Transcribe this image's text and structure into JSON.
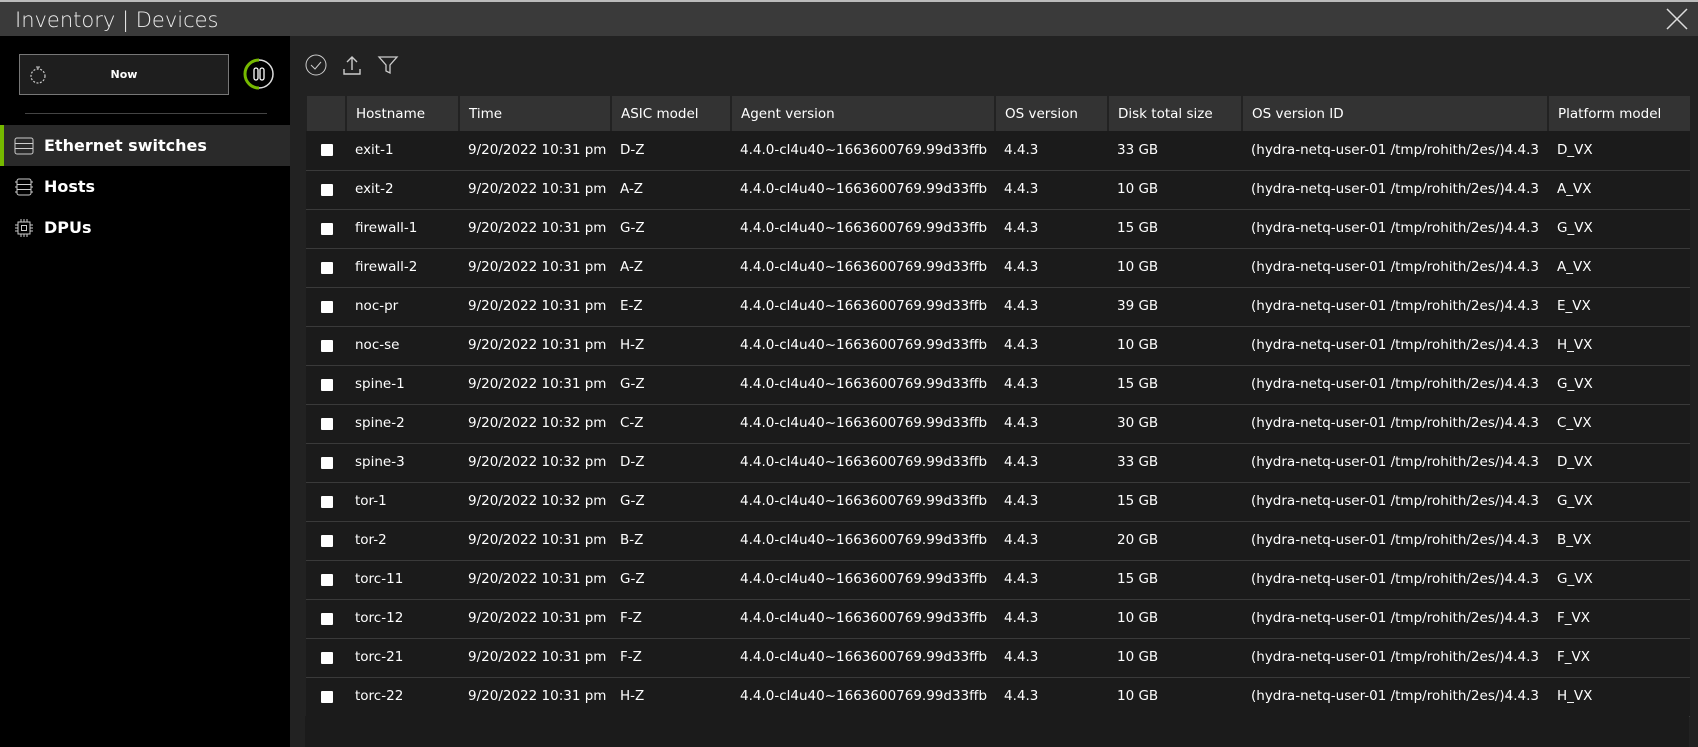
{
  "window": {
    "title": "Inventory | Devices"
  },
  "time_control": {
    "label": "Now"
  },
  "sidebar": {
    "items": [
      {
        "label": "Ethernet switches",
        "icon": "switch-icon"
      },
      {
        "label": "Hosts",
        "icon": "server-icon"
      },
      {
        "label": "DPUs",
        "icon": "chip-icon"
      }
    ]
  },
  "table": {
    "columns": [
      "Hostname",
      "Time",
      "ASIC model",
      "Agent version",
      "OS version",
      "Disk total size",
      "OS version ID",
      "Platform model"
    ],
    "rows": [
      [
        "exit-1",
        "9/20/2022 10:31 pm",
        "D-Z",
        "4.4.0-cl4u40~1663600769.99d33ffb",
        "4.4.3",
        "33 GB",
        "(hydra-netq-user-01 /tmp/rohith/2es/)4.4.3",
        "D_VX"
      ],
      [
        "exit-2",
        "9/20/2022 10:31 pm",
        "A-Z",
        "4.4.0-cl4u40~1663600769.99d33ffb",
        "4.4.3",
        "10 GB",
        "(hydra-netq-user-01 /tmp/rohith/2es/)4.4.3",
        "A_VX"
      ],
      [
        "firewall-1",
        "9/20/2022 10:31 pm",
        "G-Z",
        "4.4.0-cl4u40~1663600769.99d33ffb",
        "4.4.3",
        "15 GB",
        "(hydra-netq-user-01 /tmp/rohith/2es/)4.4.3",
        "G_VX"
      ],
      [
        "firewall-2",
        "9/20/2022 10:31 pm",
        "A-Z",
        "4.4.0-cl4u40~1663600769.99d33ffb",
        "4.4.3",
        "10 GB",
        "(hydra-netq-user-01 /tmp/rohith/2es/)4.4.3",
        "A_VX"
      ],
      [
        "noc-pr",
        "9/20/2022 10:31 pm",
        "E-Z",
        "4.4.0-cl4u40~1663600769.99d33ffb",
        "4.4.3",
        "39 GB",
        "(hydra-netq-user-01 /tmp/rohith/2es/)4.4.3",
        "E_VX"
      ],
      [
        "noc-se",
        "9/20/2022 10:31 pm",
        "H-Z",
        "4.4.0-cl4u40~1663600769.99d33ffb",
        "4.4.3",
        "10 GB",
        "(hydra-netq-user-01 /tmp/rohith/2es/)4.4.3",
        "H_VX"
      ],
      [
        "spine-1",
        "9/20/2022 10:31 pm",
        "G-Z",
        "4.4.0-cl4u40~1663600769.99d33ffb",
        "4.4.3",
        "15 GB",
        "(hydra-netq-user-01 /tmp/rohith/2es/)4.4.3",
        "G_VX"
      ],
      [
        "spine-2",
        "9/20/2022 10:32 pm",
        "C-Z",
        "4.4.0-cl4u40~1663600769.99d33ffb",
        "4.4.3",
        "30 GB",
        "(hydra-netq-user-01 /tmp/rohith/2es/)4.4.3",
        "C_VX"
      ],
      [
        "spine-3",
        "9/20/2022 10:32 pm",
        "D-Z",
        "4.4.0-cl4u40~1663600769.99d33ffb",
        "4.4.3",
        "33 GB",
        "(hydra-netq-user-01 /tmp/rohith/2es/)4.4.3",
        "D_VX"
      ],
      [
        "tor-1",
        "9/20/2022 10:32 pm",
        "G-Z",
        "4.4.0-cl4u40~1663600769.99d33ffb",
        "4.4.3",
        "15 GB",
        "(hydra-netq-user-01 /tmp/rohith/2es/)4.4.3",
        "G_VX"
      ],
      [
        "tor-2",
        "9/20/2022 10:31 pm",
        "B-Z",
        "4.4.0-cl4u40~1663600769.99d33ffb",
        "4.4.3",
        "20 GB",
        "(hydra-netq-user-01 /tmp/rohith/2es/)4.4.3",
        "B_VX"
      ],
      [
        "torc-11",
        "9/20/2022 10:31 pm",
        "G-Z",
        "4.4.0-cl4u40~1663600769.99d33ffb",
        "4.4.3",
        "15 GB",
        "(hydra-netq-user-01 /tmp/rohith/2es/)4.4.3",
        "G_VX"
      ],
      [
        "torc-12",
        "9/20/2022 10:31 pm",
        "F-Z",
        "4.4.0-cl4u40~1663600769.99d33ffb",
        "4.4.3",
        "10 GB",
        "(hydra-netq-user-01 /tmp/rohith/2es/)4.4.3",
        "F_VX"
      ],
      [
        "torc-21",
        "9/20/2022 10:31 pm",
        "F-Z",
        "4.4.0-cl4u40~1663600769.99d33ffb",
        "4.4.3",
        "10 GB",
        "(hydra-netq-user-01 /tmp/rohith/2es/)4.4.3",
        "F_VX"
      ],
      [
        "torc-22",
        "9/20/2022 10:31 pm",
        "H-Z",
        "4.4.0-cl4u40~1663600769.99d33ffb",
        "4.4.3",
        "10 GB",
        "(hydra-netq-user-01 /tmp/rohith/2es/)4.4.3",
        "H_VX"
      ]
    ]
  },
  "colors": {
    "accent": "#76b900"
  }
}
